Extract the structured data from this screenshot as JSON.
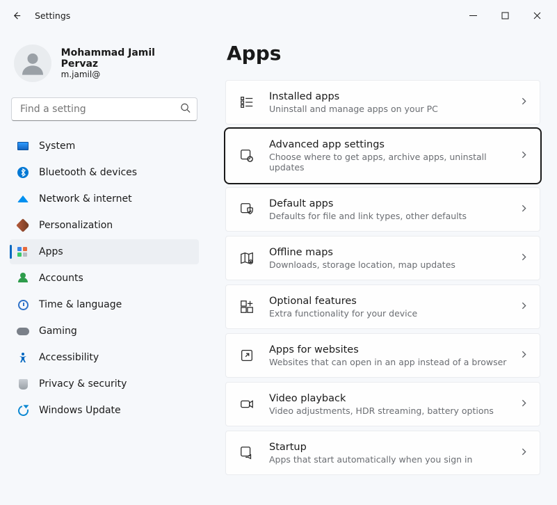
{
  "window": {
    "title": "Settings"
  },
  "user": {
    "name": "Mohammad Jamil Pervaz",
    "email": "m.jamil@"
  },
  "search": {
    "placeholder": "Find a setting"
  },
  "nav": [
    {
      "id": "system",
      "label": "System"
    },
    {
      "id": "bluetooth",
      "label": "Bluetooth & devices"
    },
    {
      "id": "network",
      "label": "Network & internet"
    },
    {
      "id": "personalization",
      "label": "Personalization"
    },
    {
      "id": "apps",
      "label": "Apps",
      "selected": true
    },
    {
      "id": "accounts",
      "label": "Accounts"
    },
    {
      "id": "time",
      "label": "Time & language"
    },
    {
      "id": "gaming",
      "label": "Gaming"
    },
    {
      "id": "accessibility",
      "label": "Accessibility"
    },
    {
      "id": "privacy",
      "label": "Privacy & security"
    },
    {
      "id": "update",
      "label": "Windows Update"
    }
  ],
  "page": {
    "title": "Apps"
  },
  "cards": [
    {
      "id": "installed",
      "title": "Installed apps",
      "sub": "Uninstall and manage apps on your PC"
    },
    {
      "id": "advanced",
      "title": "Advanced app settings",
      "sub": "Choose where to get apps, archive apps, uninstall updates",
      "focused": true
    },
    {
      "id": "default",
      "title": "Default apps",
      "sub": "Defaults for file and link types, other defaults"
    },
    {
      "id": "offline",
      "title": "Offline maps",
      "sub": "Downloads, storage location, map updates"
    },
    {
      "id": "optional",
      "title": "Optional features",
      "sub": "Extra functionality for your device"
    },
    {
      "id": "websites",
      "title": "Apps for websites",
      "sub": "Websites that can open in an app instead of a browser"
    },
    {
      "id": "video",
      "title": "Video playback",
      "sub": "Video adjustments, HDR streaming, battery options"
    },
    {
      "id": "startup",
      "title": "Startup",
      "sub": "Apps that start automatically when you sign in"
    }
  ]
}
